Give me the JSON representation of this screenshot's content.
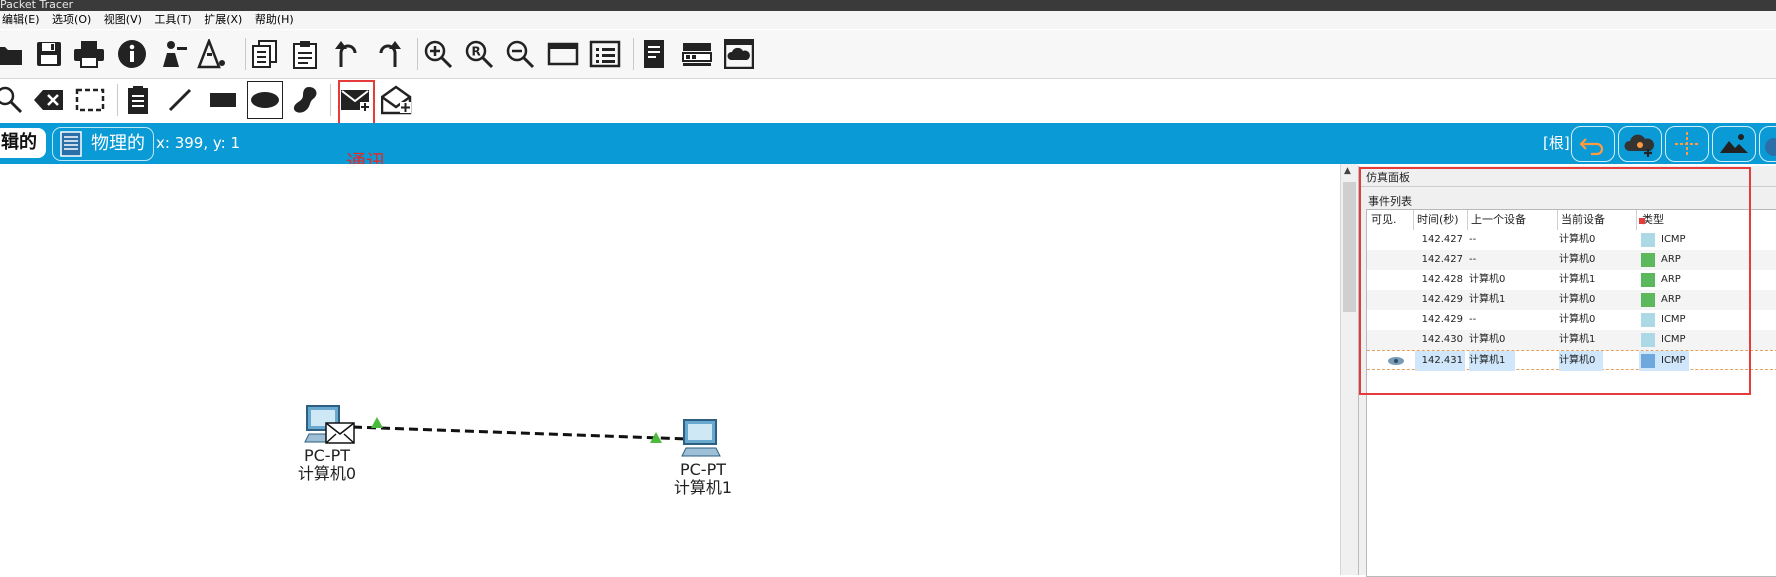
{
  "app": {
    "title": "Packet Tracer"
  },
  "menu": [
    "编辑(E)",
    "选项(O)",
    "视图(V)",
    "工具(T)",
    "扩展(X)",
    "帮助(H)"
  ],
  "toolbar1": {
    "icons": [
      "open-folder-icon",
      "save-icon",
      "print-icon",
      "info-icon",
      "wizard-icon",
      "activity-icon",
      "copy-icon",
      "paste-icon",
      "undo-icon",
      "redo-icon",
      "zoom-in-icon",
      "zoom-reset-icon",
      "zoom-out-icon",
      "drawing-palette-icon",
      "custom-device-icon",
      "notes-icon",
      "network-device-icon",
      "cloud-icon"
    ]
  },
  "toolbar2": {
    "icons": [
      "inspect-icon",
      "delete-icon",
      "resize-icon",
      "place-note-icon",
      "draw-line-icon",
      "draw-rectangle-icon",
      "draw-ellipse-icon",
      "freeform-icon",
      "add-simple-pdu-icon",
      "add-complex-pdu-icon"
    ]
  },
  "modebar": {
    "logical": "辑的",
    "physical": "物理的",
    "coords": "x: 399, y: 1",
    "root": "[根]"
  },
  "annotation": {
    "label": "通讯",
    "color": "#e53b3b"
  },
  "canvas": {
    "devices": [
      {
        "model": "PC-PT",
        "name": "计算机0"
      },
      {
        "model": "PC-PT",
        "name": "计算机1"
      }
    ]
  },
  "simpanel": {
    "title": "仿真面板",
    "event_list_title": "事件列表",
    "columns": [
      "可见.",
      "时间(秒)",
      "上一个设备",
      "当前设备",
      "类型"
    ],
    "events": [
      {
        "time": "142.427",
        "last": "--",
        "at": "计算机0",
        "type": "ICMP",
        "color": "#add8e6"
      },
      {
        "time": "142.427",
        "last": "--",
        "at": "计算机0",
        "type": "ARP",
        "color": "#5cb85c"
      },
      {
        "time": "142.428",
        "last": "计算机0",
        "at": "计算机1",
        "type": "ARP",
        "color": "#5cb85c"
      },
      {
        "time": "142.429",
        "last": "计算机1",
        "at": "计算机0",
        "type": "ARP",
        "color": "#5cb85c"
      },
      {
        "time": "142.429",
        "last": "--",
        "at": "计算机0",
        "type": "ICMP",
        "color": "#add8e6"
      },
      {
        "time": "142.430",
        "last": "计算机0",
        "at": "计算机1",
        "type": "ICMP",
        "color": "#add8e6"
      },
      {
        "time": "142.431",
        "last": "计算机1",
        "at": "计算机0",
        "type": "ICMP",
        "color": "#6fa8dc",
        "selected": true
      }
    ]
  },
  "colors": {
    "modebar": "#0a9ad6",
    "arp": "#5cb85c",
    "icmp": "#add8e6"
  }
}
